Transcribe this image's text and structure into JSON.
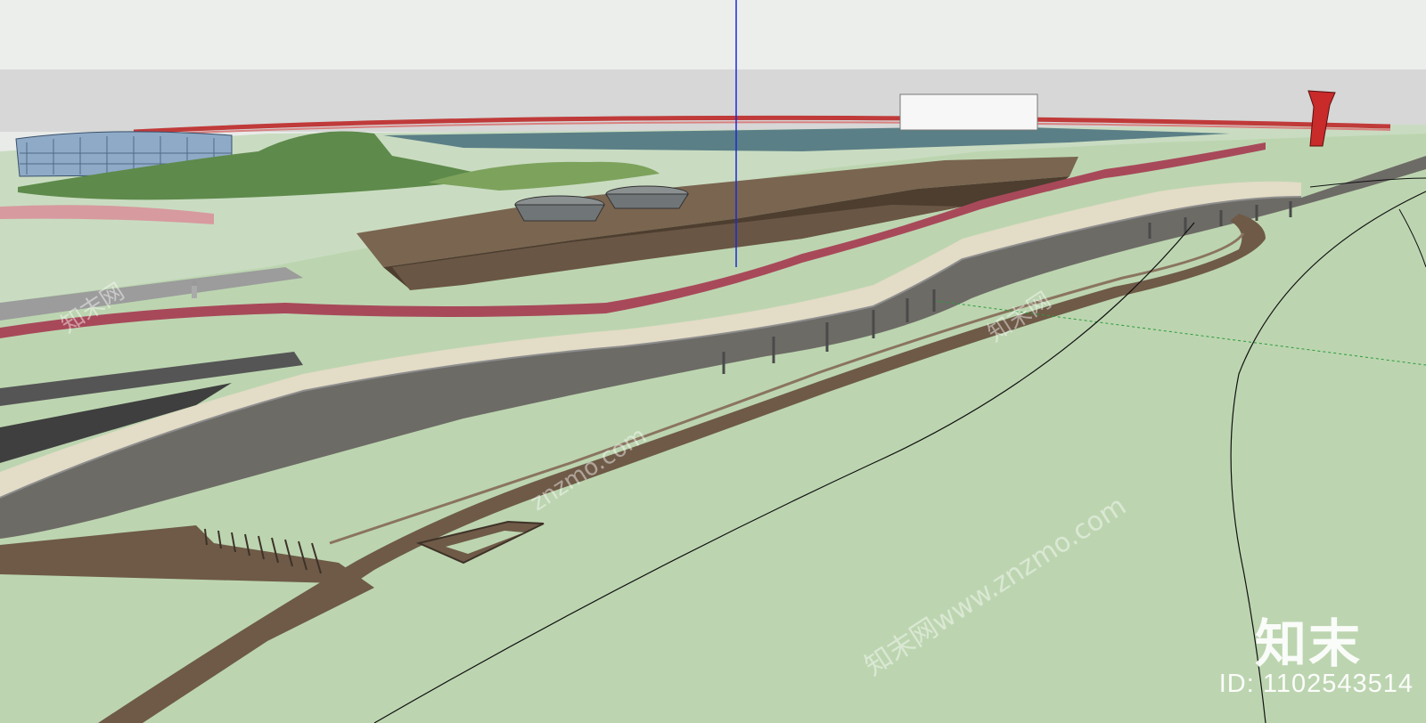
{
  "overlay": {
    "brand": "知末",
    "asset_id": "ID: 1102543514"
  },
  "watermarks": {
    "text_a": "知末网www.znzmo.com",
    "text_b": "znzmo.com",
    "text_c": "知末网"
  },
  "colors": {
    "sky": "#e9ebe9",
    "haze": "#d7d8d7",
    "grass": "#b9d3ad",
    "grass_light": "#c8dcc0",
    "lawn": "#5f8a4c",
    "water": "#5a7f86",
    "deck": "#6f5a44",
    "deck_dark": "#4e3f30",
    "retaining_wall": "#6c6a66",
    "promenade": "#e5dec8",
    "path_red": "#a94a57",
    "road": "#555555",
    "railing": "#c03030",
    "axis": "#1b2bd6",
    "glass": "#8faac7"
  }
}
